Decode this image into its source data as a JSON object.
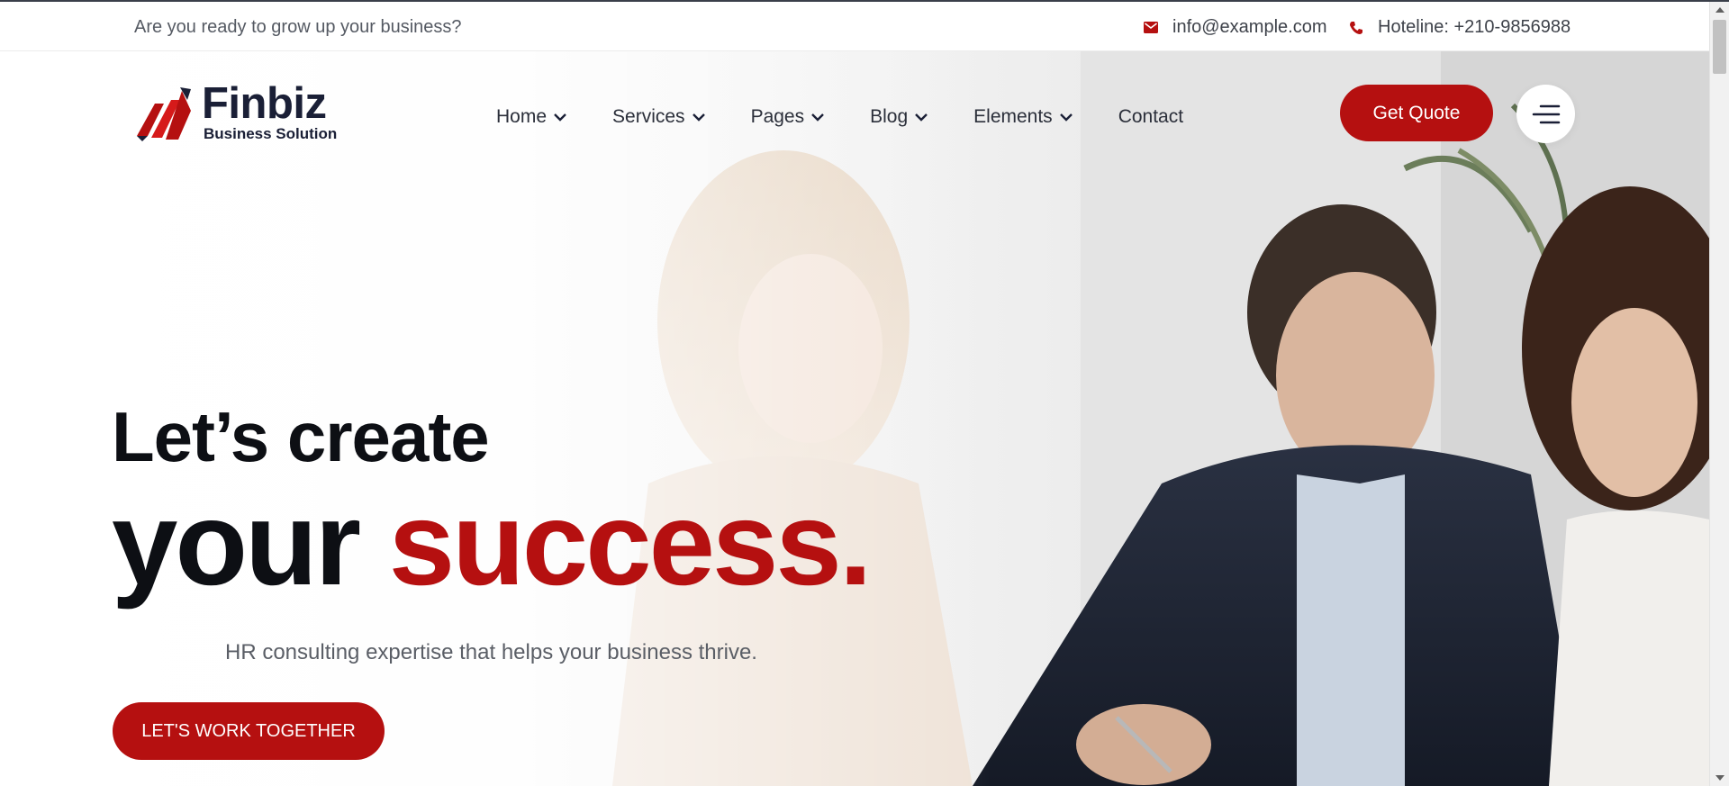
{
  "topbar": {
    "tagline": "Are you ready to grow up your business?",
    "email": "info@example.com",
    "hotline": "Hoteline: +210-9856988",
    "email_icon": "envelope-icon",
    "phone_icon": "phone-icon"
  },
  "brand": {
    "name": "Finbiz",
    "subtitle": "Business Solution",
    "accent_color": "#b51010",
    "dark_color": "#1a1f36"
  },
  "nav": {
    "items": [
      {
        "label": "Home",
        "has_dropdown": true
      },
      {
        "label": "Services",
        "has_dropdown": true
      },
      {
        "label": "Pages",
        "has_dropdown": true
      },
      {
        "label": "Blog",
        "has_dropdown": true
      },
      {
        "label": "Elements",
        "has_dropdown": true
      },
      {
        "label": "Contact",
        "has_dropdown": false
      }
    ],
    "quote_button": "Get Quote",
    "menu_icon": "hamburger-menu-icon"
  },
  "hero": {
    "line1": "Let’s create",
    "line2_dark": "your",
    "line2_accent": "success.",
    "subtitle": "HR consulting expertise that helps your business thrive.",
    "cta": "LET'S WORK TOGETHER"
  }
}
